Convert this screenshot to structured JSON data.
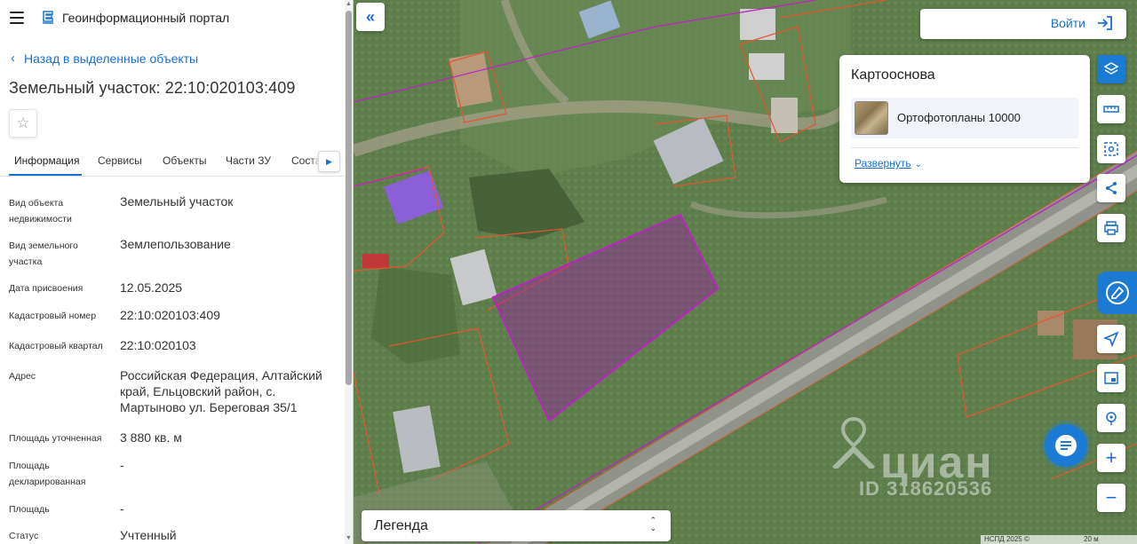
{
  "header": {
    "portal_title": "Геоинформационный портал",
    "back_link": "Назад в выделенные объекты",
    "page_title": "Земельный участок: 22:10:020103:409"
  },
  "tabs": [
    {
      "label": "Информация"
    },
    {
      "label": "Сервисы"
    },
    {
      "label": "Объекты"
    },
    {
      "label": "Части ЗУ"
    },
    {
      "label": "Соста"
    }
  ],
  "info": [
    {
      "label": "Вид объекта недвижимости",
      "value": "Земельный участок"
    },
    {
      "label": "Вид земельного участка",
      "value": "Землепользование"
    },
    {
      "label": "Дата присвоения",
      "value": "12.05.2025"
    },
    {
      "label": "Кадастровый номер",
      "value": "22:10:020103:409"
    },
    {
      "label": "Кадастровый квартал",
      "value": "22:10:020103"
    },
    {
      "label": "Адрес",
      "value": "Российская Федерация, Алтайский край, Ельцовский район, с. Мартыново ул. Береговая 35/1"
    },
    {
      "label": "Площадь уточненная",
      "value": "3 880 кв. м"
    },
    {
      "label": "Площадь декларированная",
      "value": "-"
    },
    {
      "label": "Площадь",
      "value": "-"
    },
    {
      "label": "Статус",
      "value": "Учтенный"
    }
  ],
  "map": {
    "login_label": "Войти",
    "basemap": {
      "title": "Картооснова",
      "selected": "Ортофотопланы 10000",
      "expand_label": "Развернуть"
    },
    "legend_label": "Легенда",
    "watermark_brand": "циан",
    "watermark_id": "ID 318620536",
    "attribution": "НСПД 2025 ©",
    "scale_label": "20 м"
  },
  "colors": {
    "accent": "#1a7ad4",
    "link": "#1a6fd0",
    "parcel_highlight": "#b000c8",
    "cadastral_lines": "#e8542e"
  }
}
